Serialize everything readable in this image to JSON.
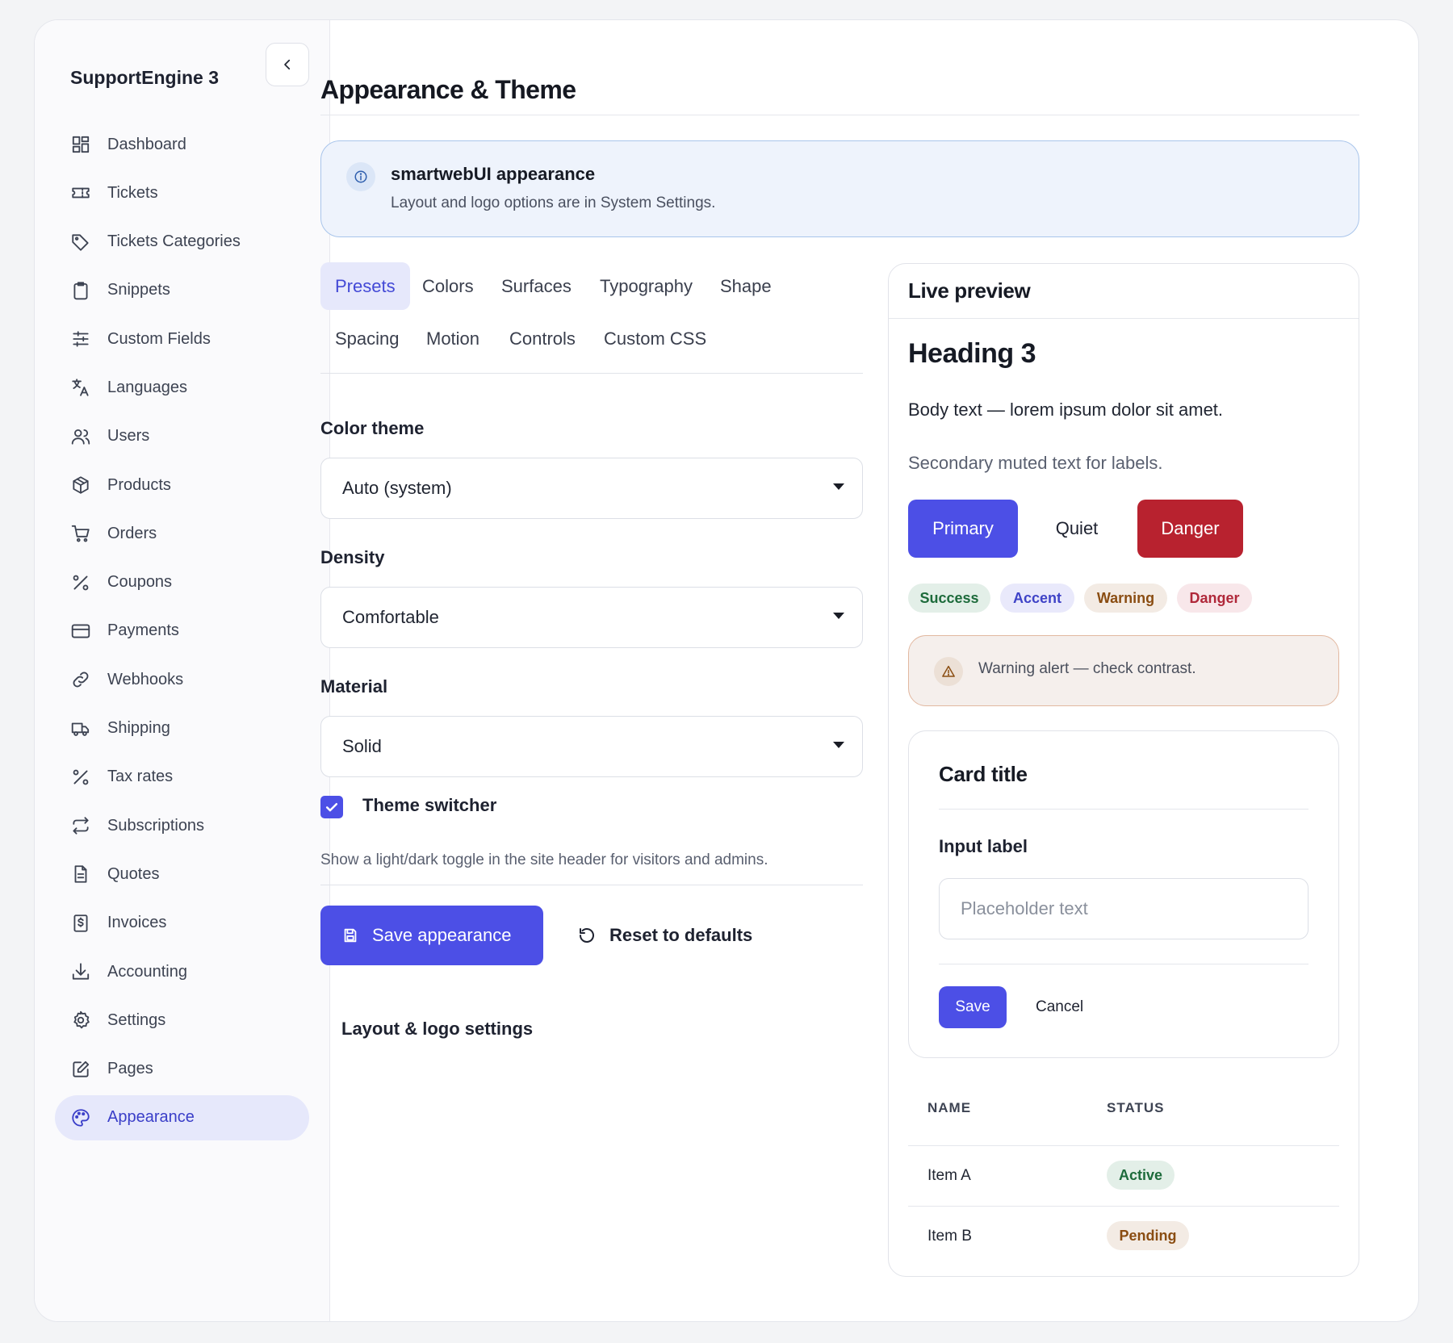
{
  "app": {
    "name": "SupportEngine 3"
  },
  "sidebar": {
    "items": [
      {
        "label": "Dashboard",
        "icon": "dashboard-icon"
      },
      {
        "label": "Tickets",
        "icon": "ticket-icon"
      },
      {
        "label": "Tickets Categories",
        "icon": "tag-icon"
      },
      {
        "label": "Snippets",
        "icon": "clipboard-icon"
      },
      {
        "label": "Custom Fields",
        "icon": "sliders-icon"
      },
      {
        "label": "Languages",
        "icon": "translate-icon"
      },
      {
        "label": "Users",
        "icon": "users-icon"
      },
      {
        "label": "Products",
        "icon": "box-icon"
      },
      {
        "label": "Orders",
        "icon": "cart-icon"
      },
      {
        "label": "Coupons",
        "icon": "percent-icon"
      },
      {
        "label": "Payments",
        "icon": "credit-card-icon"
      },
      {
        "label": "Webhooks",
        "icon": "link-icon"
      },
      {
        "label": "Shipping",
        "icon": "truck-icon"
      },
      {
        "label": "Tax rates",
        "icon": "percent-icon"
      },
      {
        "label": "Subscriptions",
        "icon": "repeat-icon"
      },
      {
        "label": "Quotes",
        "icon": "document-icon"
      },
      {
        "label": "Invoices",
        "icon": "invoice-icon"
      },
      {
        "label": "Accounting",
        "icon": "download-icon"
      },
      {
        "label": "Settings",
        "icon": "gear-icon"
      },
      {
        "label": "Pages",
        "icon": "edit-icon"
      },
      {
        "label": "Appearance",
        "icon": "palette-icon",
        "active": true
      }
    ]
  },
  "page": {
    "title": "Appearance & Theme"
  },
  "info": {
    "title": "smartwebUI appearance",
    "subtitle": "Layout and logo options are in System Settings."
  },
  "tabs": [
    {
      "label": "Presets",
      "active": true
    },
    {
      "label": "Colors"
    },
    {
      "label": "Surfaces"
    },
    {
      "label": "Typography"
    },
    {
      "label": "Shape"
    },
    {
      "label": "Spacing"
    },
    {
      "label": "Motion"
    },
    {
      "label": "Controls"
    },
    {
      "label": "Custom CSS"
    }
  ],
  "form": {
    "color_theme": {
      "label": "Color theme",
      "value": "Auto (system)"
    },
    "density": {
      "label": "Density",
      "value": "Comfortable"
    },
    "material": {
      "label": "Material",
      "value": "Solid"
    },
    "theme_switcher": {
      "label": "Theme switcher",
      "checked": true,
      "help": "Show a light/dark toggle in the site header for visitors and admins."
    },
    "save_label": "Save appearance",
    "reset_label": "Reset to defaults",
    "layout_link": "Layout & logo settings"
  },
  "preview": {
    "title": "Live preview",
    "heading": "Heading 3",
    "body": "Body text — lorem ipsum dolor sit amet.",
    "muted": "Secondary muted text for labels.",
    "buttons": {
      "primary": "Primary",
      "quiet": "Quiet",
      "danger": "Danger"
    },
    "badges": {
      "success": "Success",
      "accent": "Accent",
      "warning": "Warning",
      "danger": "Danger"
    },
    "alert": "Warning alert — check contrast.",
    "card": {
      "title": "Card title",
      "input_label": "Input label",
      "input_placeholder": "Placeholder text",
      "save": "Save",
      "cancel": "Cancel"
    },
    "table": {
      "headers": [
        "NAME",
        "STATUS"
      ],
      "rows": [
        {
          "name": "Item A",
          "status": "Active",
          "tone": "success"
        },
        {
          "name": "Item B",
          "status": "Pending",
          "tone": "warning"
        }
      ]
    }
  },
  "colors": {
    "accent": "#4c4fe6",
    "danger": "#b8222f",
    "active_nav_bg": "#e6e8fb",
    "info_bg": "#eef3fc",
    "warning_bg": "#f5efec"
  }
}
